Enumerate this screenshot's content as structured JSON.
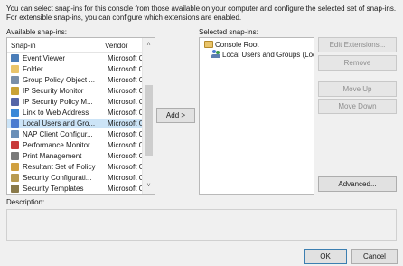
{
  "intro_text": "You can select snap-ins for this console from those available on your computer and configure the selected set of snap-ins. For extensible snap-ins, you can configure which extensions are enabled.",
  "available": {
    "label": "Available snap-ins:",
    "columns": {
      "snapin": "Snap-in",
      "vendor": "Vendor"
    },
    "items": [
      {
        "name": "Event Viewer",
        "vendor": "Microsoft Cor...",
        "icon": "event-viewer-icon",
        "color": "#4a7db8"
      },
      {
        "name": "Folder",
        "vendor": "Microsoft Cor...",
        "icon": "folder-icon",
        "color": "#e9c46a"
      },
      {
        "name": "Group Policy Object ...",
        "vendor": "Microsoft Cor...",
        "icon": "group-policy-icon",
        "color": "#7a8fa8"
      },
      {
        "name": "IP Security Monitor",
        "vendor": "Microsoft Cor...",
        "icon": "ip-security-monitor-icon",
        "color": "#c9a236"
      },
      {
        "name": "IP Security Policy M...",
        "vendor": "Microsoft Cor...",
        "icon": "ip-security-policy-icon",
        "color": "#5566a8"
      },
      {
        "name": "Link to Web Address",
        "vendor": "Microsoft Cor...",
        "icon": "web-link-icon",
        "color": "#3b88d8"
      },
      {
        "name": "Local Users and Gro...",
        "vendor": "Microsoft Cor...",
        "icon": "local-users-icon",
        "color": "#4a7bd0"
      },
      {
        "name": "NAP Client Configur...",
        "vendor": "Microsoft Cor...",
        "icon": "nap-client-icon",
        "color": "#6a8fb8"
      },
      {
        "name": "Performance Monitor",
        "vendor": "Microsoft Cor...",
        "icon": "performance-monitor-icon",
        "color": "#c83a3a"
      },
      {
        "name": "Print Management",
        "vendor": "Microsoft Cor...",
        "icon": "printer-icon",
        "color": "#7a7a7a"
      },
      {
        "name": "Resultant Set of Policy",
        "vendor": "Microsoft Cor...",
        "icon": "rsop-icon",
        "color": "#d0a040"
      },
      {
        "name": "Security Configurati...",
        "vendor": "Microsoft Cor...",
        "icon": "security-config-icon",
        "color": "#b89a50"
      },
      {
        "name": "Security Templates",
        "vendor": "Microsoft Cor...",
        "icon": "security-templates-icon",
        "color": "#8a7a4a"
      }
    ],
    "selected_index": 6
  },
  "add_button": "Add >",
  "selected": {
    "label": "Selected snap-ins:",
    "root": "Console Root",
    "child": "Local Users and Groups (Local)"
  },
  "buttons": {
    "edit_extensions": "Edit Extensions...",
    "remove": "Remove",
    "move_up": "Move Up",
    "move_down": "Move Down",
    "advanced": "Advanced...",
    "ok": "OK",
    "cancel": "Cancel"
  },
  "description_label": "Description:"
}
